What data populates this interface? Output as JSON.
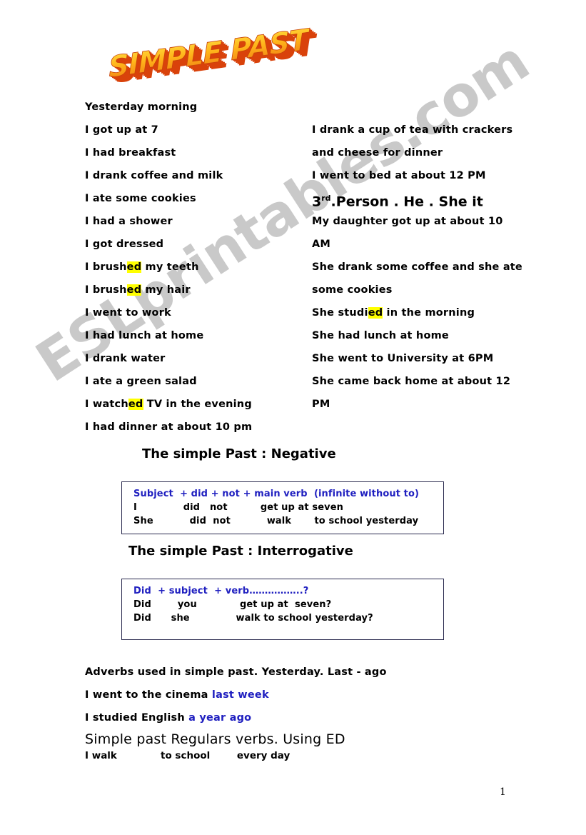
{
  "title_logo": {
    "text": "SIMPLE PAST",
    "face_color_top": "#ffd42a",
    "face_color_bottom": "#f58a1f",
    "extrusion_color": "#d9420b",
    "style": "3d-wordart"
  },
  "watermark": {
    "text": "ESLprintables.com",
    "color": "#c9c9c9"
  },
  "left_column": {
    "heading": "Yesterday morning",
    "lines": [
      {
        "text": "I got up at 7"
      },
      {
        "text": " I had breakfast"
      },
      {
        "text": "I drank coffee and milk"
      },
      {
        "text": "I ate some cookies"
      },
      {
        "text": "I had a shower"
      },
      {
        "text": "I got dressed"
      },
      {
        "pre": "I brush",
        "hl": "ed",
        "post": " my teeth"
      },
      {
        "pre": "I brush",
        "hl": "ed",
        "post": " my hair"
      },
      {
        "text": "I went to work"
      },
      {
        "text": "I had lunch at home"
      },
      {
        "text": "I drank water"
      },
      {
        "text": "I ate a green salad"
      },
      {
        "pre": "I watch",
        "hl": "ed",
        "post": " TV in the evening"
      },
      {
        "text": "I had dinner at about 10 pm"
      }
    ]
  },
  "right_column": {
    "lines_top": [
      {
        "text": "I drank a cup of tea with crackers"
      },
      {
        "text": "and cheese for dinner"
      },
      {
        "text": " I went to bed at about 12 PM"
      }
    ],
    "third_person_heading": {
      "ordinal_number": "3",
      "ordinal_suffix": "rd",
      "rest": ".Person .  He . She it"
    },
    "lines_bottom": [
      {
        "text": "My daughter got up at about 10"
      },
      {
        "text": "AM"
      },
      {
        "text": "She drank some coffee and she ate"
      },
      {
        "text": "some cookies"
      },
      {
        "pre": "She studi",
        "hl": "ed",
        "post": " in the morning"
      },
      {
        "text": "She had lunch at home"
      },
      {
        "text": "She went to University at 6PM"
      },
      {
        "text": "She came back home at about 12"
      },
      {
        "text": "PM"
      }
    ]
  },
  "negative_section": {
    "heading": "The simple Past : Negative",
    "formula": "Subject  + did + not + main verb  (infinite without to)",
    "formula_color": "#2020c0",
    "examples": [
      "I              did   not          get up at seven",
      "She           did  not           walk       to school yesterday"
    ]
  },
  "interrogative_section": {
    "heading": "The simple Past :  Interrogative",
    "formula": "Did  + subject  + verb……………..?",
    "formula_color": "#2020c0",
    "examples": [
      "Did        you             get up at  seven?",
      "Did      she              walk to school yesterday?"
    ]
  },
  "adverbs_section": {
    "line1": "Adverbs used in simple past.   Yesterday.   Last - ago",
    "line2_pre": "I went to the cinema ",
    "line2_blue": "last week",
    "line3_pre": "I studied English ",
    "line3_blue": "a year ago"
  },
  "regulars_section": {
    "heading": "Simple past Regulars verbs. Using ED",
    "example": "I walk             to school        every day"
  },
  "page_number": "1"
}
